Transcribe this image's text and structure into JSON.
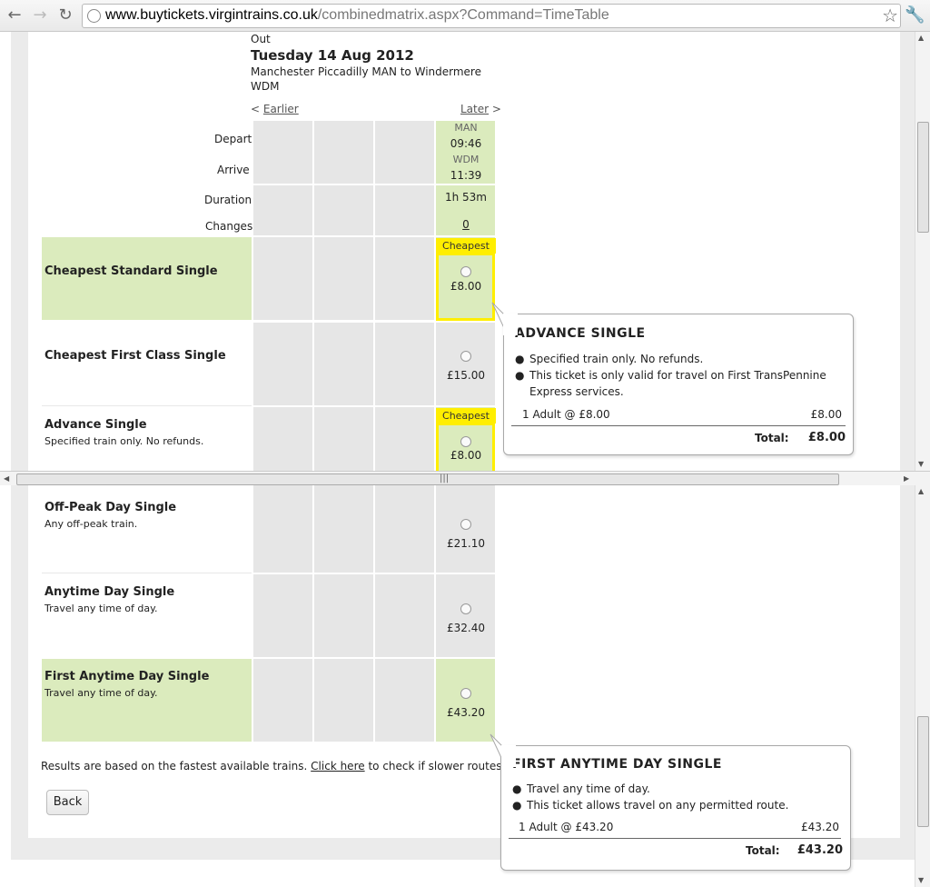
{
  "browser": {
    "url_host": "www.buytickets.virgintrains.co.uk",
    "url_path": "/combinedmatrix.aspx?Command=TimeTable"
  },
  "journey": {
    "direction": "Out",
    "date": "Tuesday 14 Aug 2012",
    "route_line1": "Manchester Piccadilly MAN to Windermere",
    "route_line2": "WDM",
    "earlier": "Earlier",
    "later": "Later",
    "labels": {
      "depart": "Depart",
      "arrive": "Arrive",
      "duration": "Duration",
      "changes": "Changes"
    },
    "train": {
      "depart_station": "MAN",
      "depart_time": "09:46",
      "arrive_station": "WDM",
      "arrive_time": "11:39",
      "duration": "1h 53m",
      "changes": "0"
    }
  },
  "fares": [
    {
      "name": "Cheapest Standard Single",
      "desc": "",
      "price": "£8.00",
      "tag": "Cheapest"
    },
    {
      "name": "Cheapest First Class Single",
      "desc": "",
      "price": "£15.00",
      "tag": ""
    },
    {
      "name": "Advance Single",
      "desc": "Specified train only. No refunds.",
      "price": "£8.00",
      "tag": "Cheapest"
    },
    {
      "name": "Off-Peak Day Single",
      "desc": "Any off-peak train.",
      "price": "£21.10",
      "tag": ""
    },
    {
      "name": "Anytime Day Single",
      "desc": "Travel any time of day.",
      "price": "£32.40",
      "tag": ""
    },
    {
      "name": "First Anytime Day Single",
      "desc": "Travel any time of day.",
      "price": "£43.20",
      "tag": ""
    }
  ],
  "tooltip1": {
    "title": "ADVANCE SINGLE",
    "bullets": [
      "Specified train only. No refunds.",
      "This ticket is only valid for travel on First TransPennine Express services."
    ],
    "line_label": "1 Adult @ £8.00",
    "line_value": "£8.00",
    "total_label": "Total:",
    "total_value": "£8.00"
  },
  "tooltip2": {
    "title": "FIRST ANYTIME DAY SINGLE",
    "bullets": [
      "Travel any time of day.",
      "This ticket allows travel on any permitted route."
    ],
    "line_label": "1 Adult @ £43.20",
    "line_value": "£43.20",
    "total_label": "Total:",
    "total_value": "£43.20"
  },
  "footer": {
    "note_before": "Results are based on the fastest available trains.",
    "note_link": "Click here",
    "note_after": "to check if slower routes w",
    "back": "Back"
  },
  "colors": {
    "green": "#dbebbd",
    "grey": "#e6e6e6",
    "yellow": "#ffee00"
  }
}
